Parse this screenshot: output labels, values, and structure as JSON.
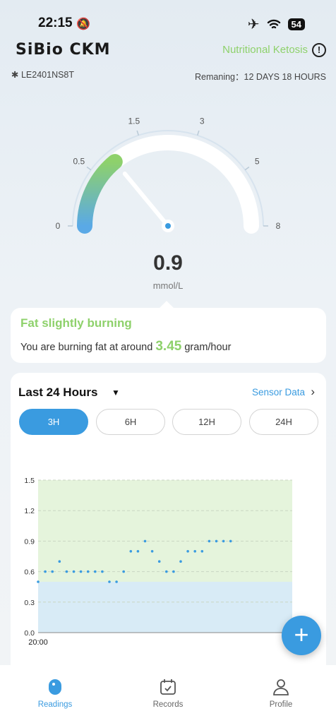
{
  "status_bar": {
    "time": "22:15",
    "battery": "54"
  },
  "header": {
    "logo": "SiBio CKM",
    "state": "Nutritional Ketosis",
    "device_id": "LE2401NS8T",
    "remaining": "Remaning：12 DAYS 18 HOURS"
  },
  "gauge": {
    "value": "0.9",
    "unit": "mmol/L",
    "ticks": [
      "0",
      "0.5",
      "1.5",
      "3",
      "5",
      "8"
    ],
    "level": 0.9
  },
  "burn": {
    "title": "Fat slightly burning",
    "prefix": "You are burning fat at around",
    "rate": "3.45",
    "suffix": "gram/hour"
  },
  "history": {
    "range": "Last 24 Hours",
    "sensor_link": "Sensor Data",
    "segments": [
      "3H",
      "6H",
      "12H",
      "24H"
    ],
    "active": "3H"
  },
  "chart_data": {
    "type": "scatter",
    "x_start_label": "20:00",
    "y_ticks": [
      "0.0",
      "0.3",
      "0.6",
      "0.9",
      "1.2",
      "1.5"
    ],
    "ylim": [
      0,
      1.5
    ],
    "values": [
      0.5,
      0.6,
      0.6,
      0.7,
      0.6,
      0.6,
      0.6,
      0.6,
      0.6,
      0.6,
      0.5,
      0.5,
      0.6,
      0.8,
      0.8,
      0.9,
      0.8,
      0.7,
      0.6,
      0.6,
      0.7,
      0.8,
      0.8,
      0.8,
      0.9,
      0.9,
      0.9,
      0.9
    ],
    "bands": [
      {
        "from": 0,
        "to": 0.5,
        "color": "#d8ebf6"
      },
      {
        "from": 0.5,
        "to": 1.5,
        "color": "#e5f4dc"
      }
    ],
    "point_color": "#3a9be0"
  },
  "nav": {
    "readings": "Readings",
    "records": "Records",
    "profile": "Profile"
  },
  "colors": {
    "accent": "#3a9be0",
    "keto": "#8ed16b"
  }
}
